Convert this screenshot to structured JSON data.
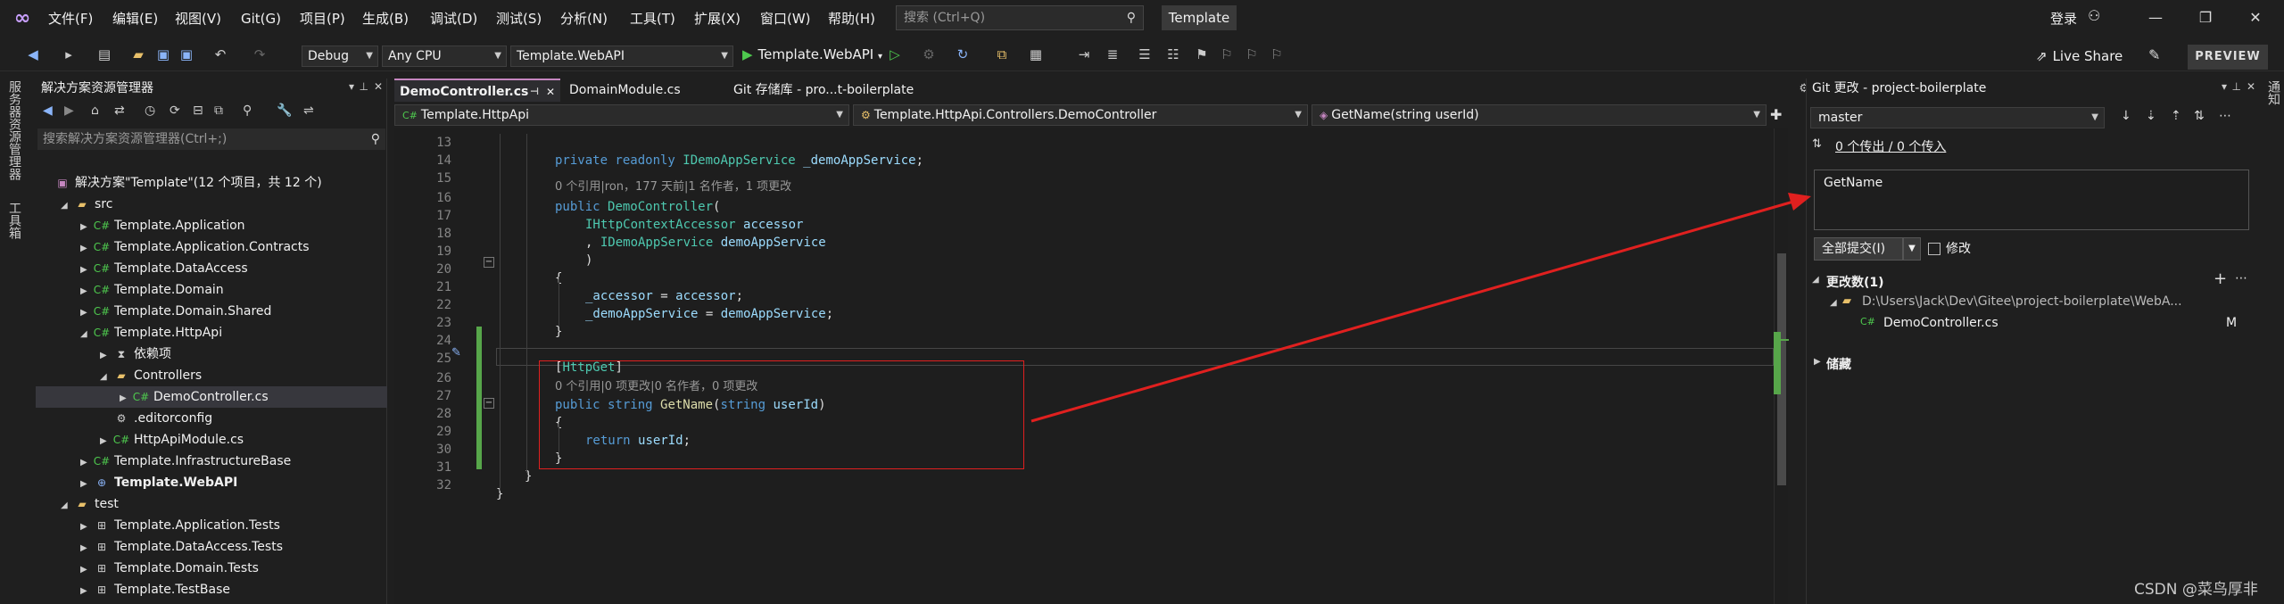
{
  "menu": {
    "items": [
      "文件(F)",
      "编辑(E)",
      "视图(V)",
      "Git(G)",
      "项目(P)",
      "生成(B)",
      "调试(D)",
      "测试(S)",
      "分析(N)",
      "工具(T)",
      "扩展(X)",
      "窗口(W)",
      "帮助(H)"
    ],
    "search_placeholder": "搜索 (Ctrl+Q)",
    "solution_name": "Template",
    "login": "登录"
  },
  "toolbar": {
    "config": "Debug",
    "platform": "Any CPU",
    "startup_project": "Template.WebAPI",
    "run_label": "Template.WebAPI",
    "live_share": "Live Share",
    "preview": "PREVIEW"
  },
  "side_strips": {
    "left": [
      "服务器资源管理器",
      "工具箱"
    ],
    "right": [
      "通知"
    ]
  },
  "solution_explorer": {
    "title": "解决方案资源管理器",
    "search_placeholder": "搜索解决方案资源管理器(Ctrl+;)",
    "rows": [
      {
        "text": "解决方案\"Template\"(12 个项目，共 12 个)",
        "indent": 0,
        "exp": "",
        "icon": "solution-icon"
      },
      {
        "text": "src",
        "indent": 1,
        "exp": "◢",
        "icon": "folder-icon"
      },
      {
        "text": "Template.Application",
        "indent": 2,
        "exp": "▶",
        "icon": "csproj-icon"
      },
      {
        "text": "Template.Application.Contracts",
        "indent": 2,
        "exp": "▶",
        "icon": "csproj-icon"
      },
      {
        "text": "Template.DataAccess",
        "indent": 2,
        "exp": "▶",
        "icon": "csproj-icon"
      },
      {
        "text": "Template.Domain",
        "indent": 2,
        "exp": "▶",
        "icon": "csproj-icon"
      },
      {
        "text": "Template.Domain.Shared",
        "indent": 2,
        "exp": "▶",
        "icon": "csproj-icon"
      },
      {
        "text": "Template.HttpApi",
        "indent": 2,
        "exp": "◢",
        "icon": "csproj-icon"
      },
      {
        "text": "依赖项",
        "indent": 3,
        "exp": "▶",
        "icon": "dependencies-icon"
      },
      {
        "text": "Controllers",
        "indent": 3,
        "exp": "◢",
        "icon": "folder-icon"
      },
      {
        "text": "DemoController.cs",
        "indent": 4,
        "exp": "▶",
        "icon": "cs-file-icon"
      },
      {
        "text": ".editorconfig",
        "indent": 3,
        "exp": "",
        "icon": "config-file-icon"
      },
      {
        "text": "HttpApiModule.cs",
        "indent": 3,
        "exp": "▶",
        "icon": "cs-file-icon"
      },
      {
        "text": "Template.InfrastructureBase",
        "indent": 2,
        "exp": "▶",
        "icon": "csproj-icon"
      },
      {
        "text": "Template.WebAPI",
        "indent": 2,
        "exp": "▶",
        "icon": "webproj-icon"
      },
      {
        "text": "test",
        "indent": 1,
        "exp": "◢",
        "icon": "folder-icon"
      },
      {
        "text": "Template.Application.Tests",
        "indent": 2,
        "exp": "▶",
        "icon": "testproj-icon"
      },
      {
        "text": "Template.DataAccess.Tests",
        "indent": 2,
        "exp": "▶",
        "icon": "testproj-icon"
      },
      {
        "text": "Template.Domain.Tests",
        "indent": 2,
        "exp": "▶",
        "icon": "testproj-icon"
      },
      {
        "text": "Template.TestBase",
        "indent": 2,
        "exp": "▶",
        "icon": "testproj-icon"
      }
    ]
  },
  "editor": {
    "tabs": [
      "DemoController.cs",
      "DomainModule.cs",
      "Git 存储库 - pro...t-boilerplate"
    ],
    "nav_project": "Template.HttpApi",
    "nav_class": "Template.HttpApi.Controllers.DemoController",
    "nav_member": "GetName(string userId)",
    "lens_ctor": "0 个引用|ron，177 天前|1 名作者，1 项更改",
    "lens_method": "0 个引用|0 项更改|0 名作者，0 项更改",
    "line_numbers": [
      "13",
      "14",
      "15",
      "16",
      "17",
      "18",
      "19",
      "20",
      "21",
      "22",
      "23",
      "24",
      "25",
      "26",
      "27",
      "28",
      "29",
      "30",
      "31",
      "32"
    ]
  },
  "git_changes": {
    "title": "Git 更改 - project-boilerplate",
    "branch": "master",
    "outgoing": "0 个传出 / 0 个传入",
    "message": "GetName",
    "commit_all": "全部提交(I)",
    "amend": "修改",
    "changes_header": "更改数(1)",
    "path": "D:\\Users\\Jack\\Dev\\Gitee\\project-boilerplate\\WebA...",
    "file": "DemoController.cs",
    "file_status": "M",
    "stash": "储藏"
  },
  "watermark": "CSDN @菜鸟厚非",
  "colors": {
    "accent": "#c586c0",
    "green_bar": "#57a64a",
    "annotation": "#e0201f"
  }
}
